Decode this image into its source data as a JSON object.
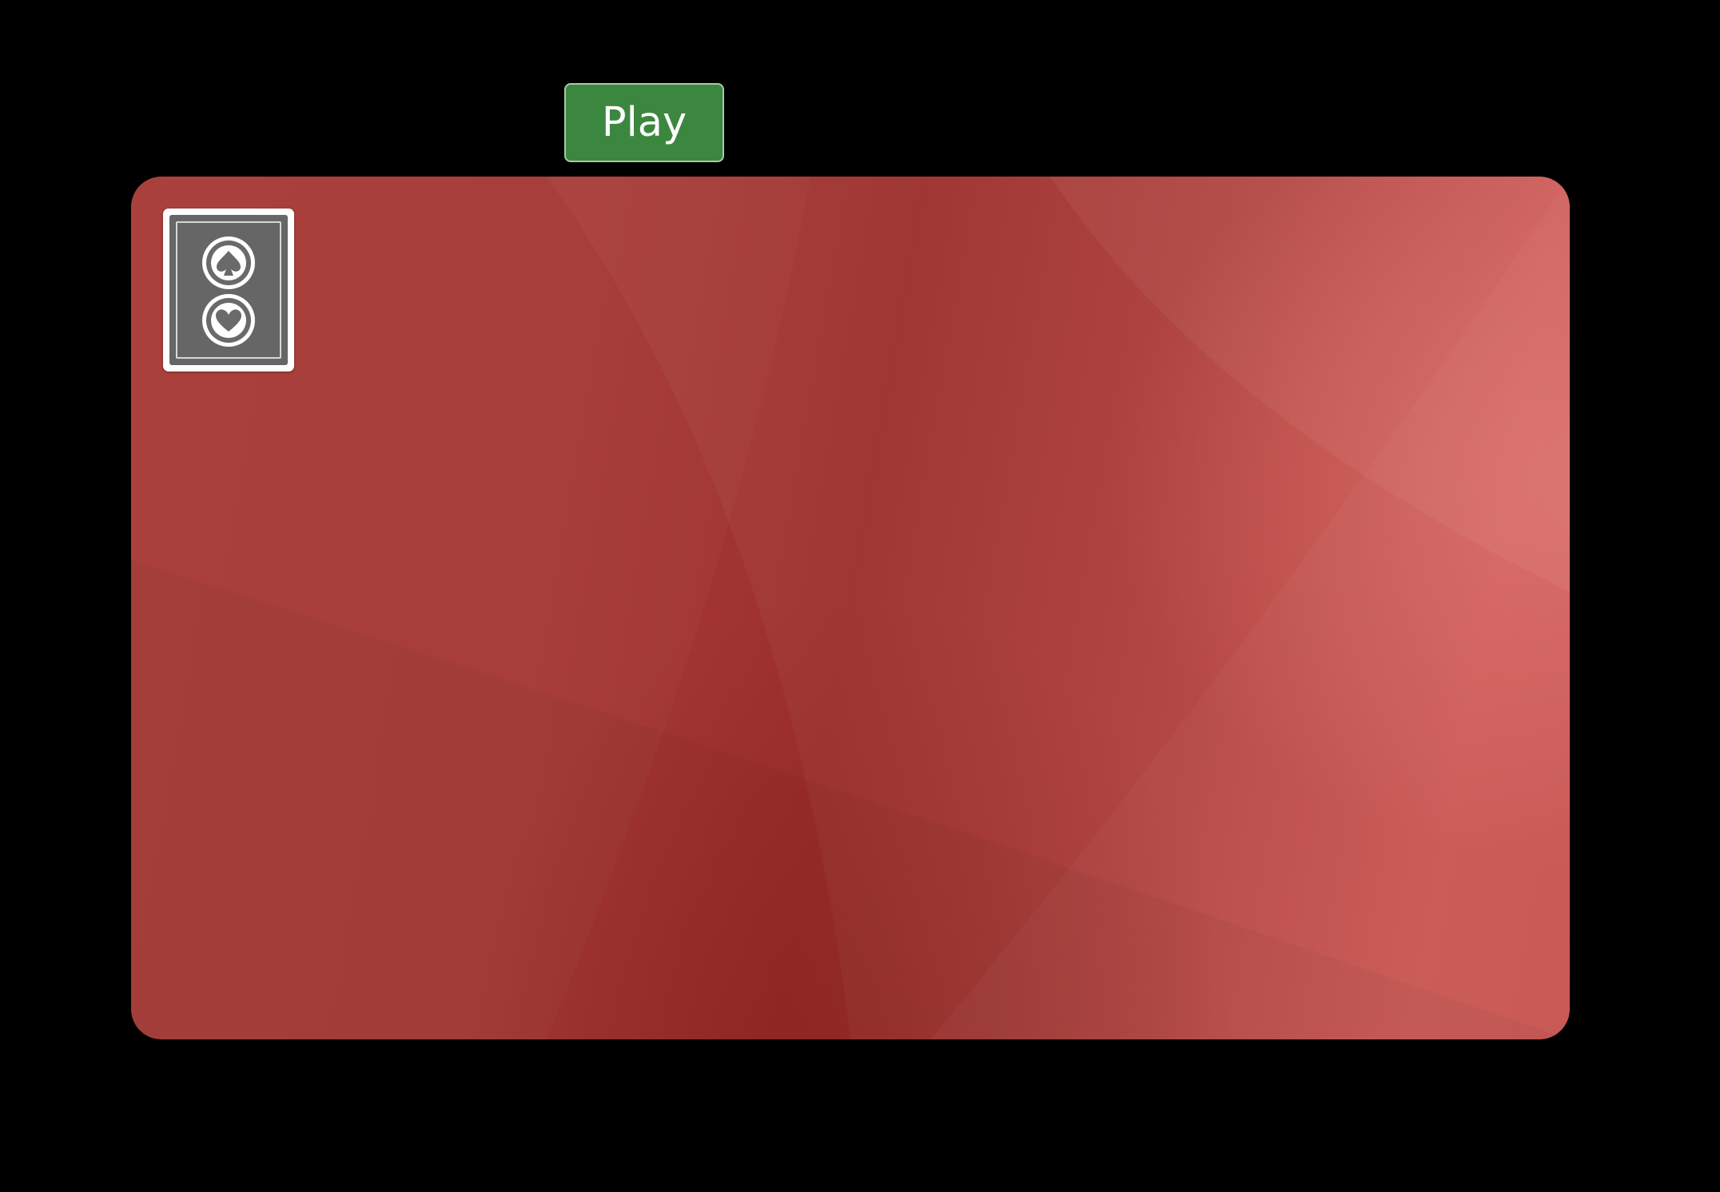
{
  "toolbar": {
    "play_label": "Play"
  },
  "table": {
    "felt_color": "#a63a36"
  },
  "deck": {
    "card_back": "grey-card-back",
    "emblems": [
      "spade-emblem-icon",
      "heart-emblem-icon"
    ]
  },
  "colors": {
    "background": "#000000",
    "play_button": "#3c873f",
    "card_back": "#666666"
  }
}
